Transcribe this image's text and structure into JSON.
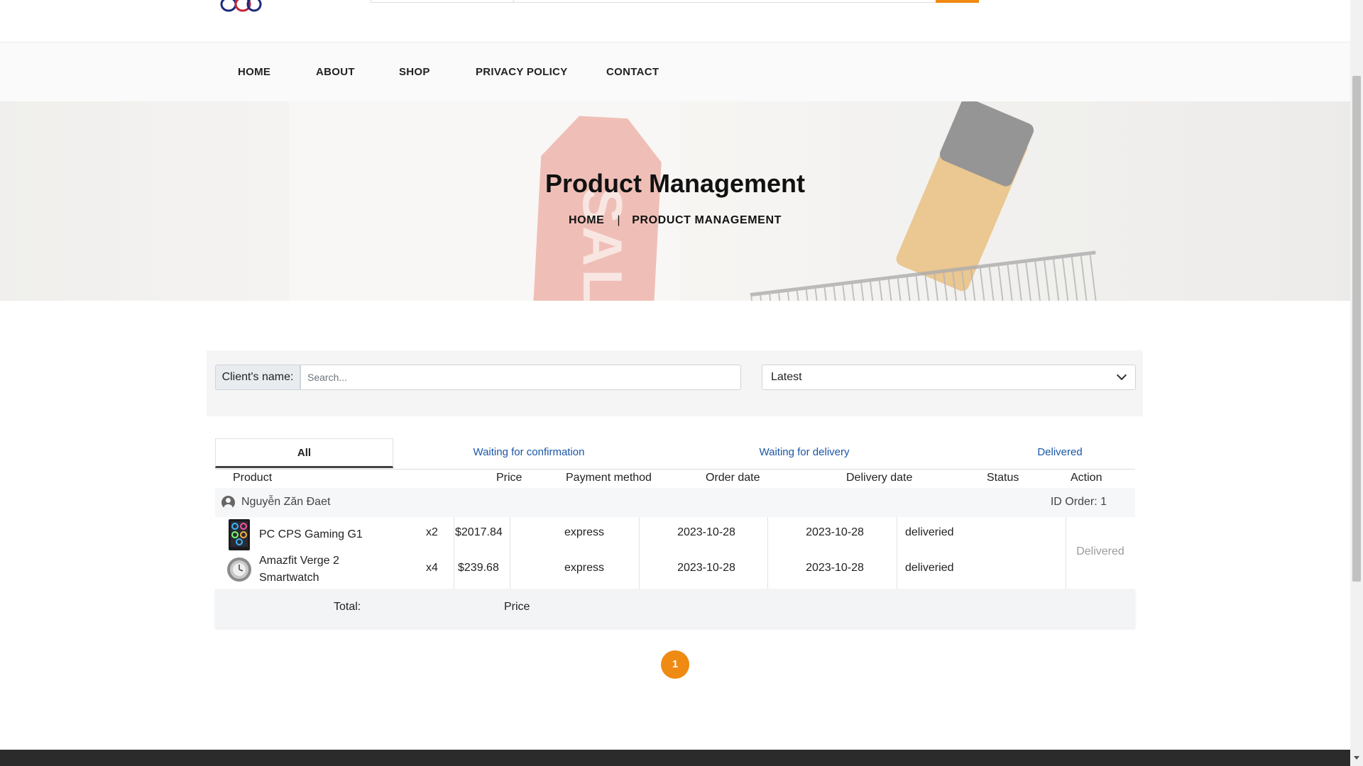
{
  "nav": {
    "items": [
      "HOME",
      "ABOUT",
      "SHOP",
      "PRIVACY POLICY",
      "CONTACT"
    ]
  },
  "hero": {
    "title": "Product Management",
    "breadcrumb_home": "HOME",
    "breadcrumb_sep": "|",
    "breadcrumb_current": "PRODUCT MANAGEMENT",
    "tag_text": "SALE"
  },
  "filter": {
    "client_label": "Client's name:",
    "search_placeholder": "Search...",
    "sort_value": "Latest"
  },
  "tabs": [
    {
      "label": "All",
      "active": true
    },
    {
      "label": "Waiting for confirmation",
      "active": false
    },
    {
      "label": "Waiting for delivery",
      "active": false
    },
    {
      "label": "Delivered",
      "active": false
    }
  ],
  "table": {
    "headers": [
      "Product",
      "Price",
      "Payment method",
      "Order date",
      "Delivery date",
      "Status",
      "Action"
    ],
    "order": {
      "customer": "Nguyễn Zăn Đaet",
      "id_label": "ID Order: 1",
      "items": [
        {
          "name": "PC CPS Gaming G1",
          "qty": "x2",
          "price": "$2017.84",
          "payment": "express",
          "order_date": "2023-10-28",
          "delivery_date": "2023-10-28",
          "status": "deliveried"
        },
        {
          "name": "Amazfit Verge 2 Smartwatch",
          "qty": "x4",
          "price": "$239.68",
          "payment": "express",
          "order_date": "2023-10-28",
          "delivery_date": "2023-10-28",
          "status": "deliveried"
        }
      ],
      "action": "Delivered",
      "total_label": "Total:",
      "total_price": "Price"
    }
  },
  "pagination": {
    "current": "1"
  },
  "colors": {
    "accent": "#ef8a12",
    "tab_link": "#1a56a6",
    "footer": "#2b2b2b"
  },
  "icons": {
    "user": "user-circle-icon",
    "chevron": "chevron-down-icon"
  }
}
